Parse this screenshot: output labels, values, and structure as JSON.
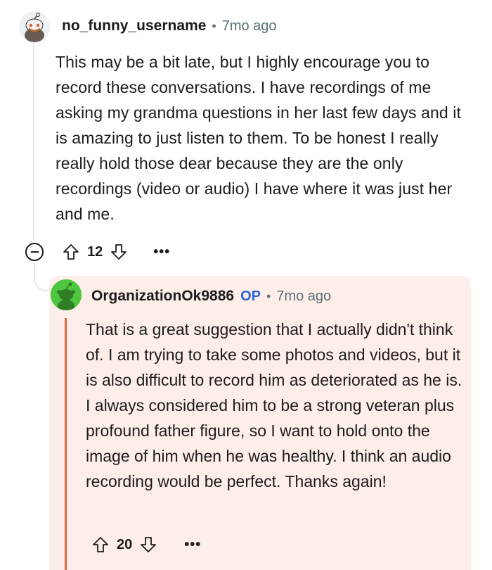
{
  "comment": {
    "username": "no_funny_username",
    "separator": "•",
    "time": "7mo ago",
    "body": "This may be a bit late, but I highly encourage you to record these conversations. I have recordings of me asking my grandma questions in her last few days and it is amazing to just listen to them. To be honest I really really hold those dear because they are the only recordings (video or audio) I have where it was just her and me.",
    "score": "12",
    "more": "•••"
  },
  "reply": {
    "username": "OrganizationOk9886",
    "op_badge": "OP",
    "separator": "•",
    "time": "7mo ago",
    "body": "That is a great suggestion that I actually didn't think of. I am trying to take some photos and videos, but it is also difficult to record him as deteriorated as he is. I always considered him to be a strong veteran plus profound father figure, so I want to hold onto the image of him when he was healthy. I think an audio recording would be perfect. Thanks again!",
    "score": "20",
    "more": "•••"
  },
  "colors": {
    "op_badge": "#2a64d6",
    "reply_background": "#fdeeea",
    "reply_accent": "#e8663b",
    "avatar_green": "#4ec63f"
  },
  "icons": [
    "snoo-avatar-icon",
    "collapse-icon",
    "upvote-icon",
    "downvote-icon",
    "more-icon"
  ]
}
